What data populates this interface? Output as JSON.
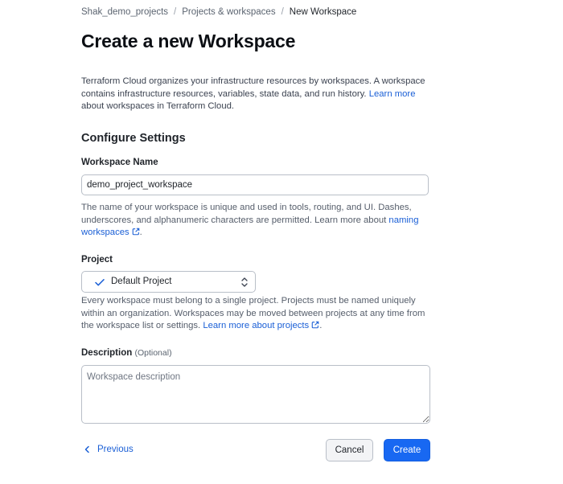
{
  "breadcrumb": {
    "items": [
      "Shak_demo_projects",
      "Projects & workspaces",
      "New Workspace"
    ],
    "separator": "/"
  },
  "page": {
    "title": "Create a new Workspace",
    "intro_text": "Terraform Cloud organizes your infrastructure resources by workspaces. A workspace contains infrastructure resources, variables, state data, and run history.",
    "intro_link": "Learn more",
    "intro_suffix": "about workspaces in Terraform Cloud."
  },
  "form": {
    "section_title": "Configure Settings",
    "workspace_name": {
      "label": "Workspace Name",
      "value": "demo_project_workspace",
      "help_text": "The name of your workspace is unique and used in tools, routing, and UI. Dashes, underscores, and alphanumeric characters are permitted. Learn more about",
      "help_link": "naming workspaces"
    },
    "project": {
      "label": "Project",
      "selected": "Default Project",
      "help_text": "Every workspace must belong to a single project. Projects must be named uniquely within an organization. Workspaces may be moved between projects at any time from the workspace list or settings.",
      "help_link": "Learn more about projects"
    },
    "description": {
      "label": "Description",
      "optional": "(Optional)",
      "placeholder": "Workspace description"
    }
  },
  "actions": {
    "previous": "Previous",
    "cancel": "Cancel",
    "create": "Create"
  },
  "colors": {
    "link": "#1a5fd6",
    "primary_button": "#1868f2"
  },
  "icons": [
    "check-icon",
    "chevron-updown-icon",
    "external-link-icon",
    "chevron-left-icon"
  ]
}
